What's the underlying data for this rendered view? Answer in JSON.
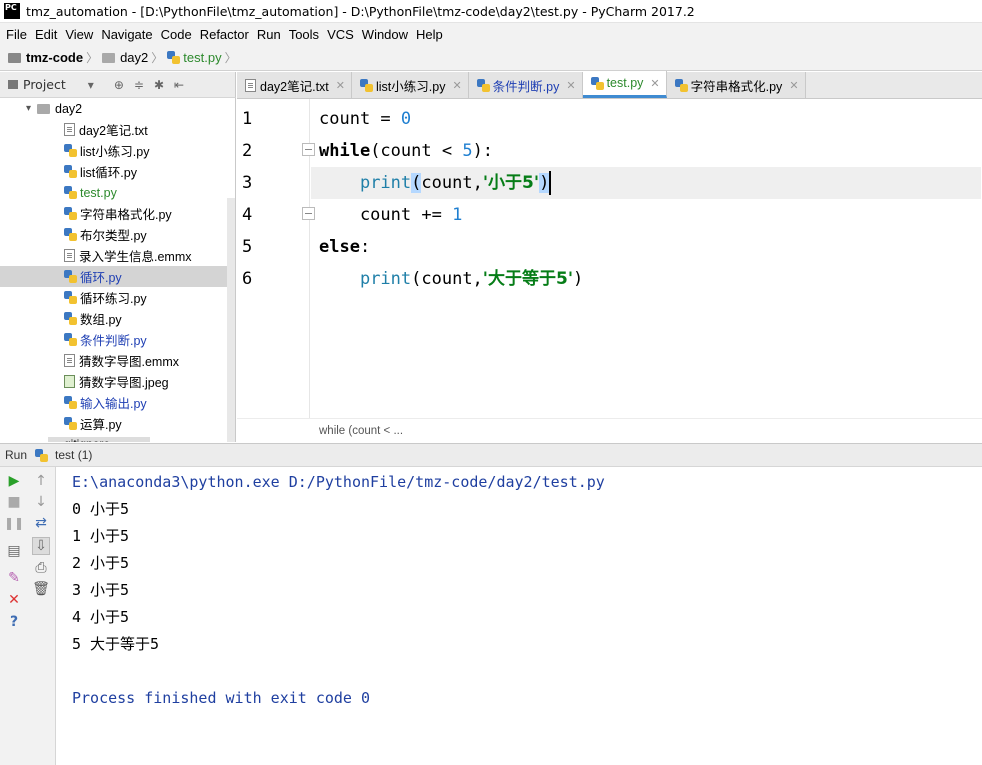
{
  "window": {
    "title": "tmz_automation - [D:\\PythonFile\\tmz_automation] - D:\\PythonFile\\tmz-code\\day2\\test.py - PyCharm 2017.2",
    "logo": "PC"
  },
  "menu": [
    "File",
    "Edit",
    "View",
    "Navigate",
    "Code",
    "Refactor",
    "Run",
    "Tools",
    "VCS",
    "Window",
    "Help"
  ],
  "breadcrumb": [
    "tmz-code",
    "day2",
    "test.py"
  ],
  "project_panel": {
    "title": "Project"
  },
  "tree": {
    "root": "day2",
    "items": [
      {
        "label": "day2笔记.txt",
        "type": "txt",
        "color": "normal"
      },
      {
        "label": "list小练习.py",
        "type": "py",
        "color": "normal"
      },
      {
        "label": "list循环.py",
        "type": "py",
        "color": "normal"
      },
      {
        "label": "test.py",
        "type": "py",
        "color": "green"
      },
      {
        "label": "字符串格式化.py",
        "type": "py",
        "color": "normal"
      },
      {
        "label": "布尔类型.py",
        "type": "py",
        "color": "normal"
      },
      {
        "label": "录入学生信息.emmx",
        "type": "file",
        "color": "normal"
      },
      {
        "label": "循环.py",
        "type": "py",
        "color": "blue",
        "selected": true
      },
      {
        "label": "循环练习.py",
        "type": "py",
        "color": "normal"
      },
      {
        "label": "数组.py",
        "type": "py",
        "color": "normal"
      },
      {
        "label": "条件判断.py",
        "type": "py",
        "color": "blue"
      },
      {
        "label": "猜数字导图.emmx",
        "type": "file",
        "color": "normal"
      },
      {
        "label": "猜数字导图.jpeg",
        "type": "img",
        "color": "normal"
      },
      {
        "label": "输入输出.py",
        "type": "py",
        "color": "blue"
      },
      {
        "label": "运算.py",
        "type": "py",
        "color": "normal"
      }
    ],
    "partial": "gitignore"
  },
  "tabs": [
    {
      "label": "day2笔记.txt",
      "icon": "txt",
      "color": "normal"
    },
    {
      "label": "list小练习.py",
      "icon": "py",
      "color": "normal"
    },
    {
      "label": "条件判断.py",
      "icon": "py",
      "color": "blue"
    },
    {
      "label": "test.py",
      "icon": "py",
      "color": "green",
      "active": true
    },
    {
      "label": "字符串格式化.py",
      "icon": "py",
      "color": "normal"
    }
  ],
  "tab_close": "✕",
  "code": {
    "l1_a": "count = ",
    "l1_num": "0",
    "l2_kw": "while",
    "l2_a": "(count < ",
    "l2_num": "5",
    "l2_b": "):",
    "l3_indent": "    ",
    "l3_fn": "print",
    "l3_p1": "(",
    "l3_a": "count,",
    "l3_str": "'小于5'",
    "l3_p2": ")",
    "l4_a": "    count += ",
    "l4_num": "1",
    "l5_kw": "else",
    "l5_a": ":",
    "l6_indent": "    ",
    "l6_fn": "print",
    "l6_a": "(count,",
    "l6_str": "'大于等于5'",
    "l6_b": ")"
  },
  "line_numbers": [
    "1",
    "2",
    "3",
    "4",
    "5",
    "6"
  ],
  "editor_footer": "while (count < ...",
  "run": {
    "label": "Run",
    "tab": "test (1)"
  },
  "console": {
    "cmd": "E:\\anaconda3\\python.exe D:/PythonFile/tmz-code/day2/test.py",
    "lines": [
      "0 小于5",
      "1 小于5",
      "2 小于5",
      "3 小于5",
      "4 小于5",
      "5 大于等于5"
    ],
    "done": "Process finished with exit code 0"
  }
}
